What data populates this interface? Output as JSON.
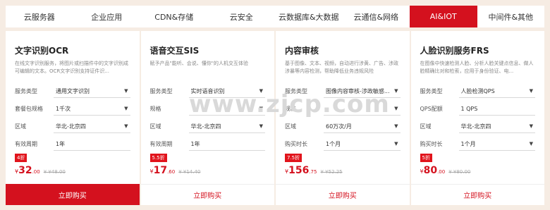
{
  "tabs": [
    {
      "label": "云服务器",
      "active": false
    },
    {
      "label": "企业应用",
      "active": false
    },
    {
      "label": "CDN&存储",
      "active": false
    },
    {
      "label": "云安全",
      "active": false
    },
    {
      "label": "云数据库&大数据",
      "active": false
    },
    {
      "label": "云通信&网络",
      "active": false
    },
    {
      "label": "AI&IOT",
      "active": true
    },
    {
      "label": "中间件&其他",
      "active": false
    }
  ],
  "cards": [
    {
      "title": "文字识别OCR",
      "desc": "在线文字识别服务，将图片或扫描件中的文字识别成可编辑的文本。OCR文字识别支持证件识...",
      "rows": [
        {
          "label": "服务类型",
          "value": "通用文字识别",
          "dropdown": true
        },
        {
          "label": "套餐包规格",
          "value": "1千次",
          "dropdown": true
        },
        {
          "label": "区域",
          "value": "华北-北京四",
          "dropdown": true
        },
        {
          "label": "有效周期",
          "value": "1年",
          "dropdown": false
        }
      ],
      "discount": "4折",
      "price_cur": "¥",
      "price_main": "32",
      "price_dec": ".00",
      "price_orig": "¥ ¥48.00",
      "buy_label": "立即购买",
      "primary": true
    },
    {
      "title": "语音交互SIS",
      "desc": "赋予产品\"能听、会说、懂你\"的人机交互体验",
      "rows": [
        {
          "label": "服务类型",
          "value": "实时语音识别",
          "dropdown": true
        },
        {
          "label": "规格",
          "value": "",
          "dropdown": true
        },
        {
          "label": "区域",
          "value": "华北-北京四",
          "dropdown": true
        },
        {
          "label": "有效周期",
          "value": "1年",
          "dropdown": false
        }
      ],
      "discount": "5.5折",
      "price_cur": "¥",
      "price_main": "17",
      "price_dec": ".60",
      "price_orig": "¥ ¥14.40",
      "buy_label": "立即购买",
      "primary": false
    },
    {
      "title": "内容审核",
      "desc": "基于图像、文本、视频，自动进行涉黄、广告、涉政涉暴等内容检测，帮助降低业务违规风险",
      "rows": [
        {
          "label": "服务类型",
          "value": "图像内容审核-涉政敏感...",
          "dropdown": true
        },
        {
          "label": "规格",
          "value": "",
          "dropdown": true
        },
        {
          "label": "区域",
          "value": "60万次/月",
          "dropdown": true
        },
        {
          "label": "购买时长",
          "value": "1个月",
          "dropdown": true
        }
      ],
      "discount": "7.5折",
      "price_cur": "¥",
      "price_main": "156",
      "price_dec": ".75",
      "price_orig": "¥ ¥52.25",
      "buy_label": "立即购买",
      "primary": false
    },
    {
      "title": "人脸识别服务FRS",
      "desc": "在图像中快速检测人脸、分析人脸关键点信息、做人脸精确比对和检索，应用于身份验证、电...",
      "rows": [
        {
          "label": "服务类型",
          "value": "人脸检测QPS",
          "dropdown": true
        },
        {
          "label": "QPS配额",
          "value": "1 QPS",
          "dropdown": false
        },
        {
          "label": "区域",
          "value": "华北-北京四",
          "dropdown": true
        },
        {
          "label": "购买时长",
          "value": "1个月",
          "dropdown": true
        }
      ],
      "discount": "5折",
      "price_cur": "¥",
      "price_main": "80",
      "price_dec": ".00",
      "price_orig": "¥ ¥80.00",
      "buy_label": "立即购买",
      "primary": false
    }
  ],
  "watermark": {
    "pre": "www.",
    "mid": "zjcp",
    "post": ".com"
  },
  "colors": {
    "accent": "#d4111e",
    "background": "#f6ece3"
  }
}
